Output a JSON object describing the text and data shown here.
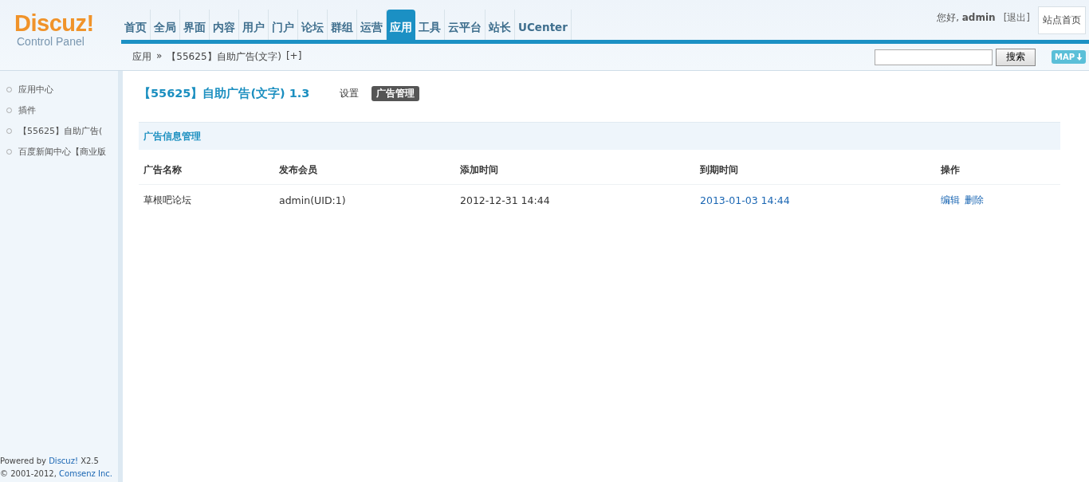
{
  "logo": {
    "title": "Discuz!",
    "subtitle": "Control Panel"
  },
  "nav": [
    {
      "label": "首页",
      "selected": false
    },
    {
      "label": "全局",
      "selected": false
    },
    {
      "label": "界面",
      "selected": false
    },
    {
      "label": "内容",
      "selected": false
    },
    {
      "label": "用户",
      "selected": false
    },
    {
      "label": "门户",
      "selected": false
    },
    {
      "label": "论坛",
      "selected": false
    },
    {
      "label": "群组",
      "selected": false
    },
    {
      "label": "运营",
      "selected": false
    },
    {
      "label": "应用",
      "selected": true
    },
    {
      "label": "工具",
      "selected": false
    },
    {
      "label": "云平台",
      "selected": false
    },
    {
      "label": "站长",
      "selected": false
    },
    {
      "label": "UCenter",
      "selected": false
    }
  ],
  "user": {
    "greeting": "您好, **admin**",
    "logout": "[退出]",
    "home_button": "站点首页"
  },
  "breadcrumb": {
    "root": "应用",
    "separator": "»",
    "current": "【55625】自助广告(文字)",
    "add": "[+]"
  },
  "search": {
    "button": "搜索",
    "map_button": "MAP"
  },
  "sidebar": {
    "items": [
      "应用中心",
      "插件",
      "【55625】自助广告(",
      "百度新闻中心【商业版"
    ]
  },
  "page": {
    "title": "【55625】自助广告(文字) 1.3",
    "tabs": [
      {
        "label": "设置",
        "selected": false
      },
      {
        "label": "广告管理",
        "selected": true
      }
    ]
  },
  "section_title": "广告信息管理",
  "table": {
    "columns": [
      "广告名称",
      "发布会员",
      "添加时间",
      "到期时间",
      "操作"
    ],
    "rows": [
      {
        "name": "草根吧论坛",
        "member": "admin(UID:1)",
        "added": "2012-12-31 14:44",
        "expires": "2013-01-03 14:44",
        "actions": [
          "编辑",
          "删除"
        ]
      }
    ]
  },
  "footer": {
    "powered": "Powered by",
    "brand": "Discuz!",
    "version": "X2.5",
    "copyright": "© 2001-2012,",
    "company": "Comsenz Inc."
  }
}
